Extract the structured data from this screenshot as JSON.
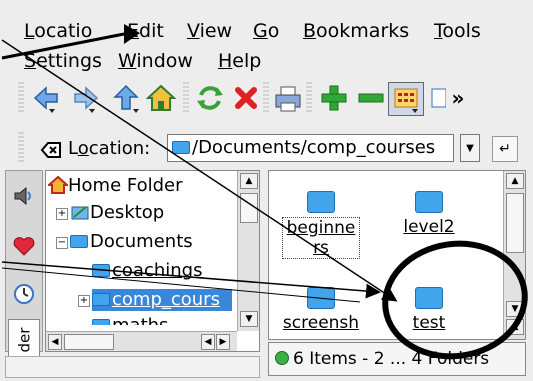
{
  "menubar": {
    "row1": [
      {
        "label": "Locatio",
        "u": "L",
        "rest": "ocatio"
      },
      {
        "label": "Edit",
        "u": "E",
        "rest": "dit"
      },
      {
        "label": "View",
        "u": "V",
        "rest": "iew"
      },
      {
        "label": "Go",
        "u": "G",
        "rest": "o"
      },
      {
        "label": "Bookmarks",
        "u": "B",
        "rest": "ookmarks"
      },
      {
        "label": "Tools",
        "u": "T",
        "rest": "ools"
      }
    ],
    "row2": [
      {
        "label": "Settings",
        "u": "S",
        "rest": "ettings"
      },
      {
        "label": "Window",
        "u": "W",
        "rest": "indow"
      },
      {
        "label": "Help",
        "u": "H",
        "rest": "elp"
      }
    ]
  },
  "toolbar": {
    "buttons": [
      "back-icon",
      "forward-icon",
      "up-icon",
      "home-icon",
      "reload-icon",
      "stop-icon",
      "print-icon",
      "zoom-in-icon",
      "zoom-out-icon",
      "icon-view-icon",
      "overflow"
    ],
    "overflow_label": "»"
  },
  "location": {
    "label_pre": "L",
    "label_u": "o",
    "label_post": "cation:",
    "value": "/Documents/comp_courses"
  },
  "tree": {
    "nodes": [
      {
        "label": "Home Folder"
      },
      {
        "label": "Desktop"
      },
      {
        "label": "Documents"
      },
      {
        "label": "coachings"
      },
      {
        "label": "comp_cours"
      },
      {
        "label": "maths"
      }
    ],
    "side_tab_label": "der"
  },
  "iconview": {
    "items": [
      {
        "label_line1": "beginne",
        "label_line2": "rs"
      },
      {
        "label_line1": "level2",
        "label_line2": ""
      },
      {
        "label_line1": "screensh",
        "label_line2": ""
      },
      {
        "label_line1": "test",
        "label_line2": ""
      }
    ]
  },
  "status": {
    "text": "6 Items - 2 ... 4 Folders"
  },
  "colors": {
    "accent": "#3a86d8",
    "folder": "#42a4ea",
    "status_ok": "#3cb043"
  }
}
